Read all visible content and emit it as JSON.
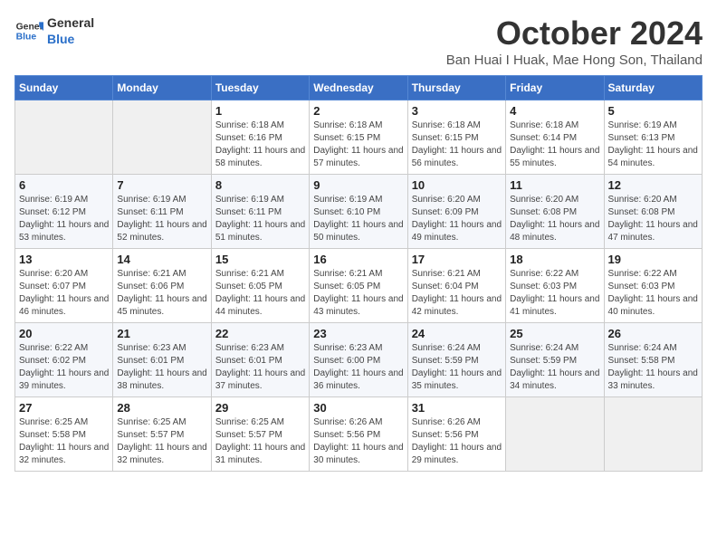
{
  "logo": {
    "line1": "General",
    "line2": "Blue"
  },
  "title": "October 2024",
  "location": "Ban Huai I Huak, Mae Hong Son, Thailand",
  "weekdays": [
    "Sunday",
    "Monday",
    "Tuesday",
    "Wednesday",
    "Thursday",
    "Friday",
    "Saturday"
  ],
  "weeks": [
    [
      {
        "day": "",
        "info": ""
      },
      {
        "day": "",
        "info": ""
      },
      {
        "day": "1",
        "info": "Sunrise: 6:18 AM\nSunset: 6:16 PM\nDaylight: 11 hours and 58 minutes."
      },
      {
        "day": "2",
        "info": "Sunrise: 6:18 AM\nSunset: 6:15 PM\nDaylight: 11 hours and 57 minutes."
      },
      {
        "day": "3",
        "info": "Sunrise: 6:18 AM\nSunset: 6:15 PM\nDaylight: 11 hours and 56 minutes."
      },
      {
        "day": "4",
        "info": "Sunrise: 6:18 AM\nSunset: 6:14 PM\nDaylight: 11 hours and 55 minutes."
      },
      {
        "day": "5",
        "info": "Sunrise: 6:19 AM\nSunset: 6:13 PM\nDaylight: 11 hours and 54 minutes."
      }
    ],
    [
      {
        "day": "6",
        "info": "Sunrise: 6:19 AM\nSunset: 6:12 PM\nDaylight: 11 hours and 53 minutes."
      },
      {
        "day": "7",
        "info": "Sunrise: 6:19 AM\nSunset: 6:11 PM\nDaylight: 11 hours and 52 minutes."
      },
      {
        "day": "8",
        "info": "Sunrise: 6:19 AM\nSunset: 6:11 PM\nDaylight: 11 hours and 51 minutes."
      },
      {
        "day": "9",
        "info": "Sunrise: 6:19 AM\nSunset: 6:10 PM\nDaylight: 11 hours and 50 minutes."
      },
      {
        "day": "10",
        "info": "Sunrise: 6:20 AM\nSunset: 6:09 PM\nDaylight: 11 hours and 49 minutes."
      },
      {
        "day": "11",
        "info": "Sunrise: 6:20 AM\nSunset: 6:08 PM\nDaylight: 11 hours and 48 minutes."
      },
      {
        "day": "12",
        "info": "Sunrise: 6:20 AM\nSunset: 6:08 PM\nDaylight: 11 hours and 47 minutes."
      }
    ],
    [
      {
        "day": "13",
        "info": "Sunrise: 6:20 AM\nSunset: 6:07 PM\nDaylight: 11 hours and 46 minutes."
      },
      {
        "day": "14",
        "info": "Sunrise: 6:21 AM\nSunset: 6:06 PM\nDaylight: 11 hours and 45 minutes."
      },
      {
        "day": "15",
        "info": "Sunrise: 6:21 AM\nSunset: 6:05 PM\nDaylight: 11 hours and 44 minutes."
      },
      {
        "day": "16",
        "info": "Sunrise: 6:21 AM\nSunset: 6:05 PM\nDaylight: 11 hours and 43 minutes."
      },
      {
        "day": "17",
        "info": "Sunrise: 6:21 AM\nSunset: 6:04 PM\nDaylight: 11 hours and 42 minutes."
      },
      {
        "day": "18",
        "info": "Sunrise: 6:22 AM\nSunset: 6:03 PM\nDaylight: 11 hours and 41 minutes."
      },
      {
        "day": "19",
        "info": "Sunrise: 6:22 AM\nSunset: 6:03 PM\nDaylight: 11 hours and 40 minutes."
      }
    ],
    [
      {
        "day": "20",
        "info": "Sunrise: 6:22 AM\nSunset: 6:02 PM\nDaylight: 11 hours and 39 minutes."
      },
      {
        "day": "21",
        "info": "Sunrise: 6:23 AM\nSunset: 6:01 PM\nDaylight: 11 hours and 38 minutes."
      },
      {
        "day": "22",
        "info": "Sunrise: 6:23 AM\nSunset: 6:01 PM\nDaylight: 11 hours and 37 minutes."
      },
      {
        "day": "23",
        "info": "Sunrise: 6:23 AM\nSunset: 6:00 PM\nDaylight: 11 hours and 36 minutes."
      },
      {
        "day": "24",
        "info": "Sunrise: 6:24 AM\nSunset: 5:59 PM\nDaylight: 11 hours and 35 minutes."
      },
      {
        "day": "25",
        "info": "Sunrise: 6:24 AM\nSunset: 5:59 PM\nDaylight: 11 hours and 34 minutes."
      },
      {
        "day": "26",
        "info": "Sunrise: 6:24 AM\nSunset: 5:58 PM\nDaylight: 11 hours and 33 minutes."
      }
    ],
    [
      {
        "day": "27",
        "info": "Sunrise: 6:25 AM\nSunset: 5:58 PM\nDaylight: 11 hours and 32 minutes."
      },
      {
        "day": "28",
        "info": "Sunrise: 6:25 AM\nSunset: 5:57 PM\nDaylight: 11 hours and 32 minutes."
      },
      {
        "day": "29",
        "info": "Sunrise: 6:25 AM\nSunset: 5:57 PM\nDaylight: 11 hours and 31 minutes."
      },
      {
        "day": "30",
        "info": "Sunrise: 6:26 AM\nSunset: 5:56 PM\nDaylight: 11 hours and 30 minutes."
      },
      {
        "day": "31",
        "info": "Sunrise: 6:26 AM\nSunset: 5:56 PM\nDaylight: 11 hours and 29 minutes."
      },
      {
        "day": "",
        "info": ""
      },
      {
        "day": "",
        "info": ""
      }
    ]
  ]
}
